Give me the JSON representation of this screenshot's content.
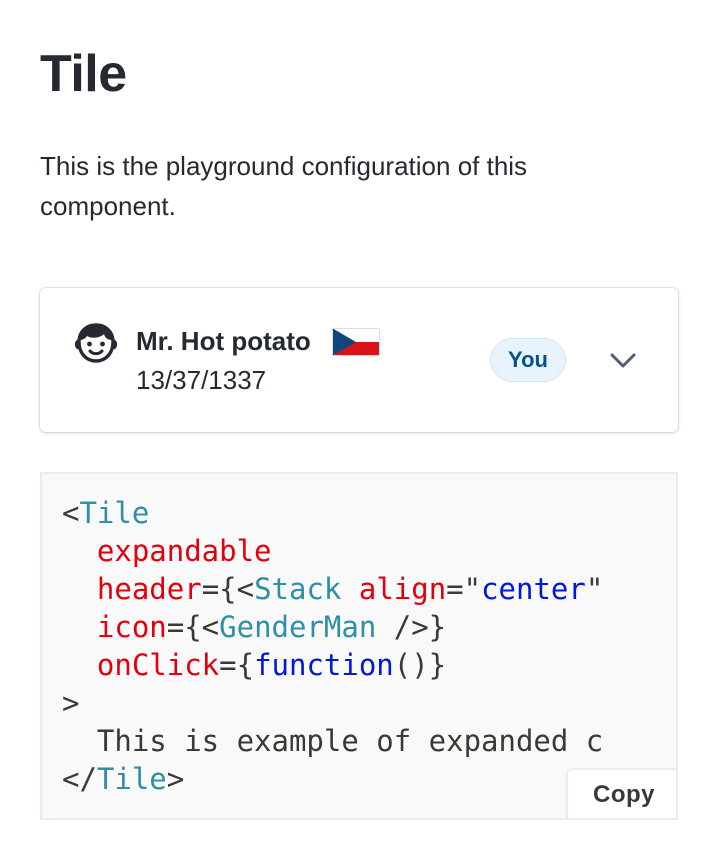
{
  "page": {
    "title": "Tile",
    "description": "This is the playground configuration of this component."
  },
  "tile": {
    "icon": "gender-man-icon",
    "name": "Mr. Hot potato",
    "flag": "czech-flag",
    "date": "13/37/1337",
    "badge": "You",
    "chevron": "chevron-down-icon"
  },
  "code": {
    "lines": [
      [
        {
          "t": "punct",
          "v": "<"
        },
        {
          "t": "tag",
          "v": "Tile"
        }
      ],
      [
        {
          "t": "punct",
          "v": "  "
        },
        {
          "t": "attr",
          "v": "expandable"
        }
      ],
      [
        {
          "t": "punct",
          "v": "  "
        },
        {
          "t": "attr",
          "v": "header"
        },
        {
          "t": "punct",
          "v": "={<"
        },
        {
          "t": "tag",
          "v": "Stack"
        },
        {
          "t": "punct",
          "v": " "
        },
        {
          "t": "attr",
          "v": "align"
        },
        {
          "t": "punct",
          "v": "=\""
        },
        {
          "t": "str",
          "v": "center"
        },
        {
          "t": "punct",
          "v": "\""
        }
      ],
      [
        {
          "t": "punct",
          "v": "  "
        },
        {
          "t": "attr",
          "v": "icon"
        },
        {
          "t": "punct",
          "v": "={<"
        },
        {
          "t": "tag",
          "v": "GenderMan"
        },
        {
          "t": "punct",
          "v": " />}"
        }
      ],
      [
        {
          "t": "punct",
          "v": "  "
        },
        {
          "t": "attr",
          "v": "onClick"
        },
        {
          "t": "punct",
          "v": "={"
        },
        {
          "t": "kw",
          "v": "function"
        },
        {
          "t": "punct",
          "v": "()}"
        }
      ],
      [
        {
          "t": "punct",
          "v": ">"
        }
      ],
      [
        {
          "t": "punct",
          "v": "  This is example of expanded c"
        }
      ],
      [
        {
          "t": "punct",
          "v": "</"
        },
        {
          "t": "tag",
          "v": "Tile"
        },
        {
          "t": "punct",
          "v": ">"
        }
      ]
    ],
    "copy_label": "Copy"
  },
  "colors": {
    "text": "#252a31",
    "badge_bg": "#e8f4fd",
    "badge_text": "#08508c",
    "code_tag": "#2e8fa7",
    "code_attr": "#e3000c",
    "code_string": "#0019d8"
  }
}
